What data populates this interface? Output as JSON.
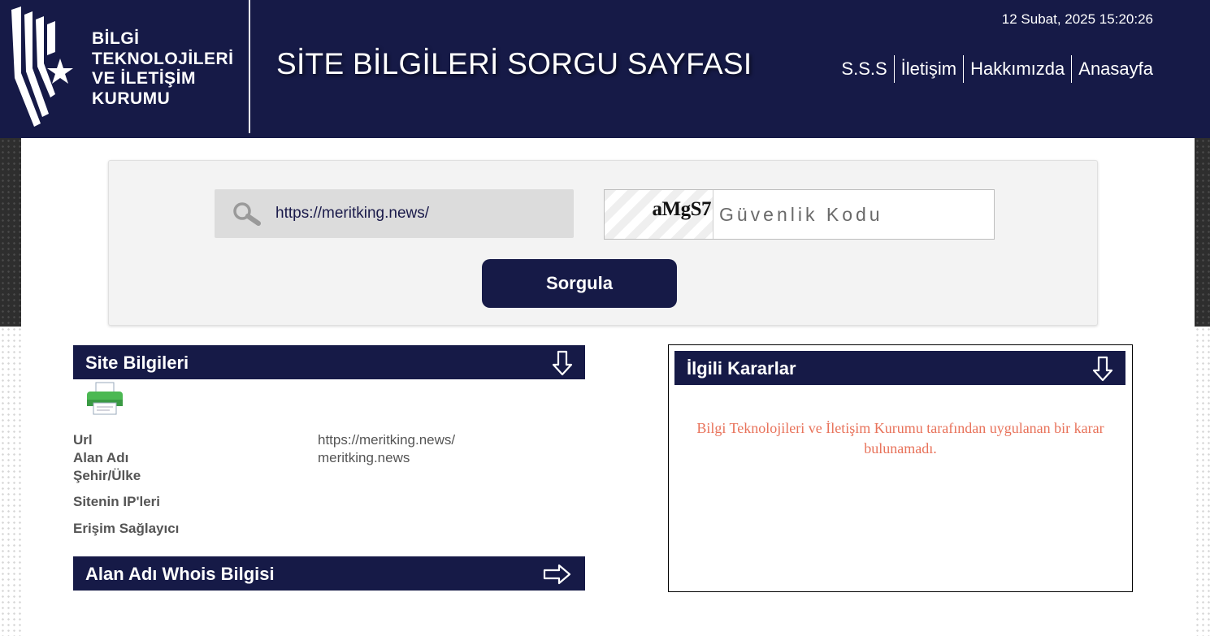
{
  "header": {
    "logo_text": "BİLGİ\nTEKNOLOJİLERİ\nVE İLETİŞİM\nKURUMU",
    "title": "SİTE BİLGİLERİ SORGU SAYFASI",
    "datetime": "12 Subat, 2025 15:20:26",
    "nav": [
      "S.S.S",
      "İletişim",
      "Hakkımızda",
      "Anasayfa"
    ]
  },
  "search": {
    "url_value": "https://meritking.news/",
    "captcha_text": "aMgS7",
    "captcha_placeholder": "Güvenlik Kodu",
    "submit_label": "Sorgula"
  },
  "site_info": {
    "title": "Site Bilgileri",
    "labels": [
      "Url",
      "Alan Adı",
      "Şehir/Ülke",
      "Sitenin IP'leri",
      "Erişim Sağlayıcı"
    ],
    "values": [
      "https://meritking.news/",
      "meritking.news"
    ]
  },
  "whois": {
    "title": "Alan Adı Whois Bilgisi"
  },
  "decisions": {
    "title": "İlgili Kararlar",
    "message": "Bilgi Teknolojileri ve İletişim Kurumu tarafından uygulanan bir karar bulunamadı."
  },
  "colors": {
    "navy": "#161a47",
    "message": "#e8725a",
    "panel": "#f3f3f3"
  }
}
